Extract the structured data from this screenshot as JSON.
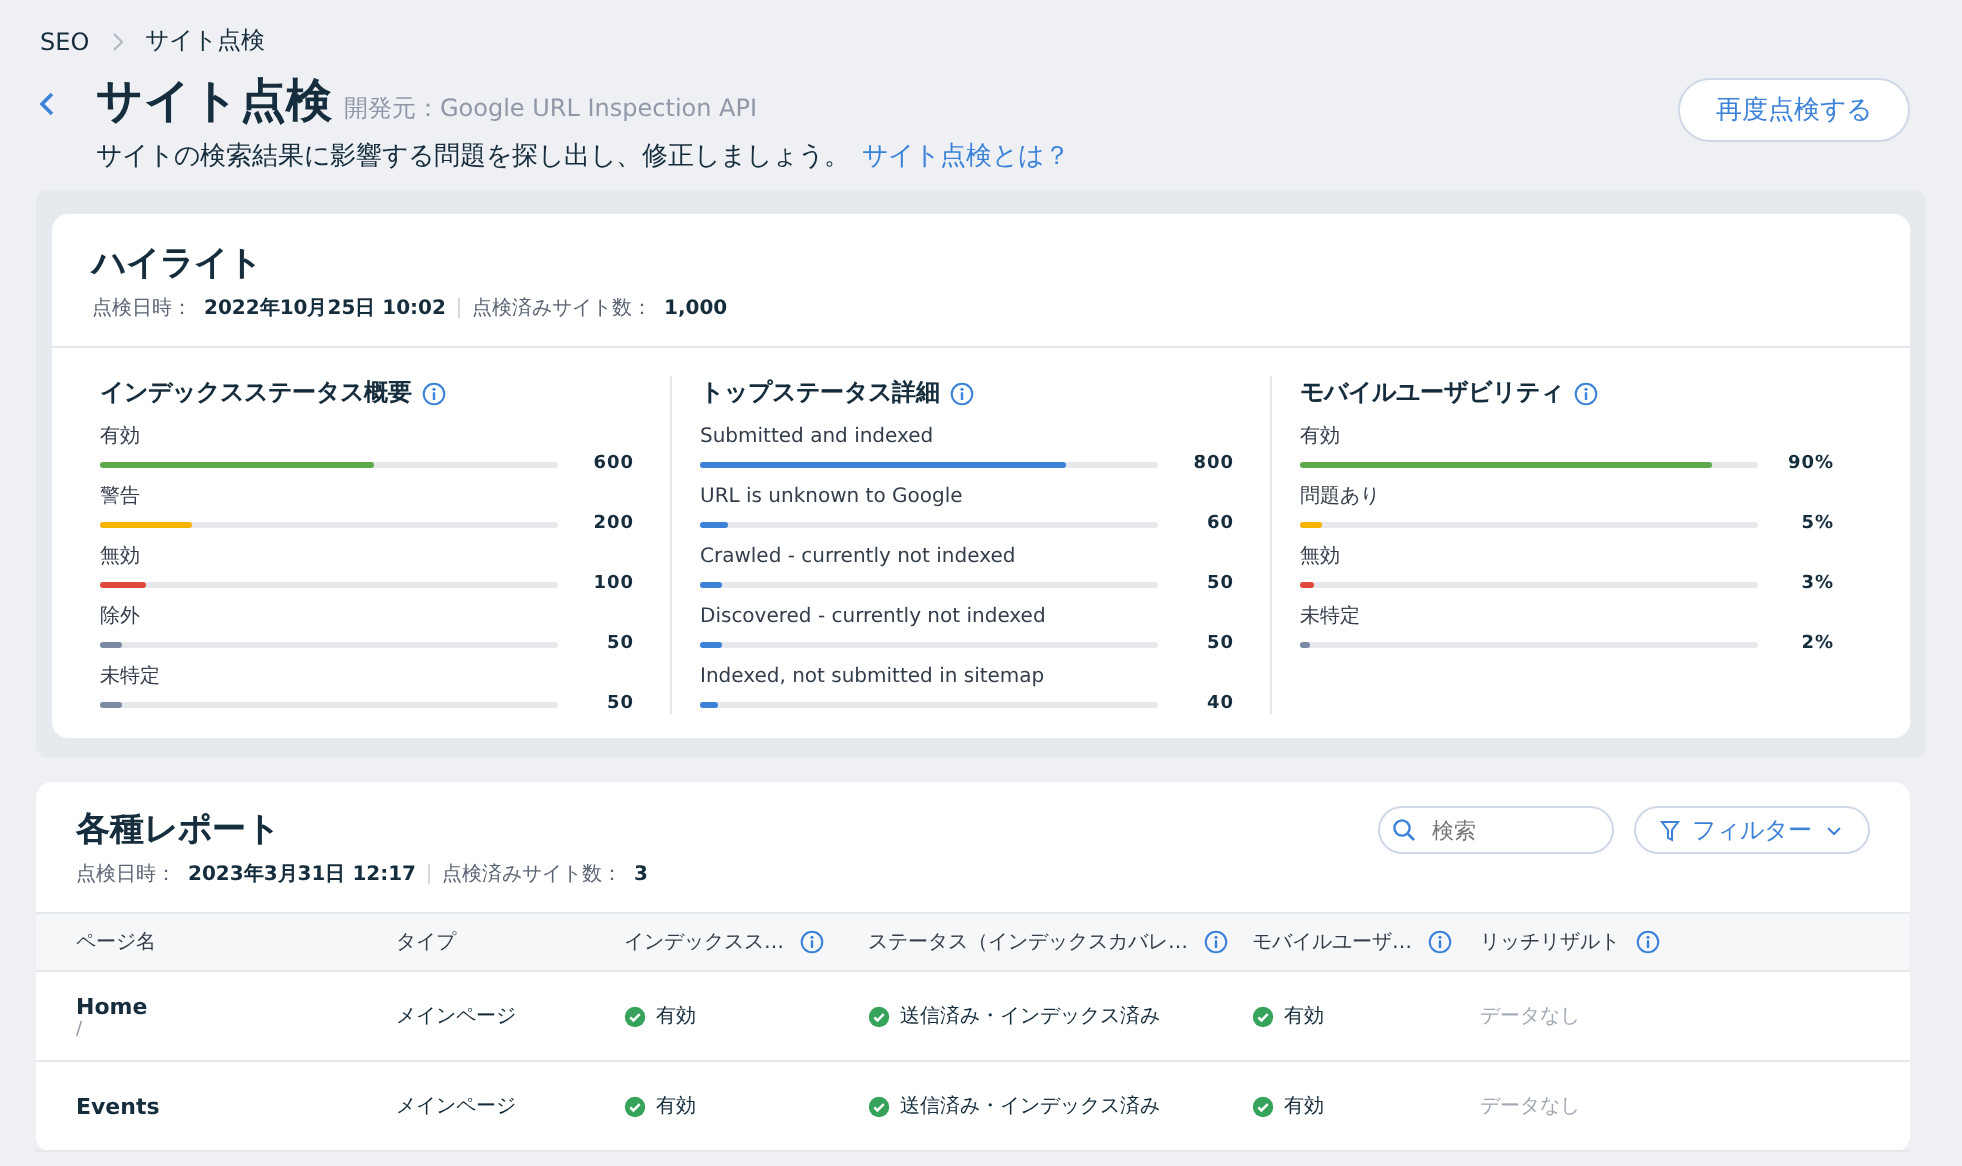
{
  "breadcrumb": [
    "SEO",
    "サイト点検"
  ],
  "header": {
    "title": "サイト点検",
    "source": "開発元：Google URL Inspection API",
    "description": "サイトの検索結果に影響する問題を探し出し、修正しましょう。",
    "link": "サイト点検とは？",
    "button": "再度点検する"
  },
  "highlights": {
    "title": "ハイライト",
    "meta": [
      {
        "label": "点検日時：",
        "value": "2022年10月25日 10:02"
      },
      {
        "label": "点検済みサイト数：",
        "value": "1,000"
      }
    ],
    "groups": [
      {
        "title": "インデックスステータス概要",
        "items": [
          {
            "label": "有効",
            "value": "600",
            "level": 0.6,
            "color": "#5fa94d"
          },
          {
            "label": "警告",
            "value": "200",
            "level": 0.2,
            "color": "#f7b500"
          },
          {
            "label": "無効",
            "value": "100",
            "level": 0.1,
            "color": "#e0483e"
          },
          {
            "label": "除外",
            "value": "50",
            "level": 0.05,
            "color": "#7a8ba3"
          },
          {
            "label": "未特定",
            "value": "50",
            "level": 0.05,
            "color": "#7a8ba3"
          }
        ]
      },
      {
        "title": "トップステータス詳細",
        "items": [
          {
            "label": "Submitted and indexed",
            "value": "800",
            "level": 0.8,
            "color": "#3b82d8"
          },
          {
            "label": "URL is unknown to Google",
            "value": "60",
            "level": 0.06,
            "color": "#3b82d8"
          },
          {
            "label": "Crawled - currently not indexed",
            "value": "50",
            "level": 0.05,
            "color": "#3b82d8"
          },
          {
            "label": "Discovered - currently not indexed",
            "value": "50",
            "level": 0.05,
            "color": "#3b82d8"
          },
          {
            "label": "Indexed, not submitted in sitemap",
            "value": "40",
            "level": 0.04,
            "color": "#3b82d8"
          }
        ]
      },
      {
        "title": "モバイルユーザビリティ",
        "items": [
          {
            "label": "有効",
            "value": "90%",
            "level": 0.9,
            "color": "#5fa94d"
          },
          {
            "label": "問題あり",
            "value": "5%",
            "level": 0.05,
            "color": "#f7b500"
          },
          {
            "label": "無効",
            "value": "3%",
            "level": 0.03,
            "color": "#e0483e"
          },
          {
            "label": "未特定",
            "value": "2%",
            "level": 0.02,
            "color": "#7a8ba3"
          }
        ]
      }
    ]
  },
  "reports": {
    "title": "各種レポート",
    "meta": [
      {
        "label": "点検日時：",
        "value": "2023年3月31日 12:17"
      },
      {
        "label": "点検済みサイト数：",
        "value": "3"
      }
    ],
    "search": {
      "placeholder": "検索"
    },
    "filter": "フィルター",
    "columns": [
      {
        "label": "ページ名",
        "info": false
      },
      {
        "label": "タイプ",
        "info": false
      },
      {
        "label": "インデックスス…",
        "info": true
      },
      {
        "label": "ステータス（インデックスカバレ…",
        "info": true
      },
      {
        "label": "モバイルユーザ…",
        "info": true
      },
      {
        "label": "リッチリザルト",
        "info": true
      }
    ],
    "rows": [
      {
        "cells": [
          {
            "kind": "page",
            "text": "Home",
            "path": "/"
          },
          {
            "kind": "text",
            "text": "メインページ"
          },
          {
            "kind": "ok",
            "text": "有効"
          },
          {
            "kind": "ok",
            "text": "送信済み・インデックス済み"
          },
          {
            "kind": "ok",
            "text": "有効"
          },
          {
            "kind": "none",
            "text": "データなし"
          }
        ]
      },
      {
        "cells": [
          {
            "kind": "page",
            "text": "Events"
          },
          {
            "kind": "text",
            "text": "メインページ"
          },
          {
            "kind": "ok",
            "text": "有効"
          },
          {
            "kind": "ok",
            "text": "送信済み・インデックス済み"
          },
          {
            "kind": "ok",
            "text": "有効"
          },
          {
            "kind": "none",
            "text": "データなし"
          }
        ]
      }
    ]
  }
}
